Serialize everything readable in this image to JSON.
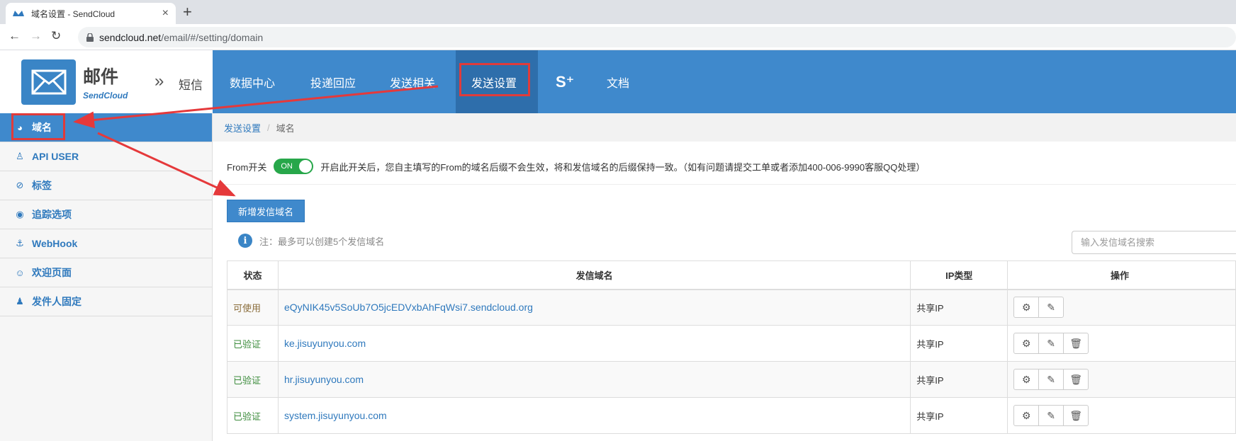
{
  "browser": {
    "tab_title": "域名设置 - SendCloud",
    "tab_close": "×",
    "new_tab": "+",
    "url_host": "sendcloud.net",
    "url_path": "/email/#/setting/domain",
    "back": "←",
    "forward": "→",
    "reload": "↻"
  },
  "brand": {
    "title": "邮件",
    "subtitle": "SendCloud",
    "switch_arrow": "»",
    "sms": "短信"
  },
  "topnav": {
    "items": [
      {
        "label": "数据中心"
      },
      {
        "label": "投递回应"
      },
      {
        "label": "发送相关"
      },
      {
        "label": "发送设置"
      },
      {
        "label": "S⁺"
      },
      {
        "label": "文档"
      }
    ],
    "active_index": 3
  },
  "sidebar": {
    "items": [
      {
        "label": "域名",
        "icon": "globe-icon",
        "glyph": "◕"
      },
      {
        "label": "API USER",
        "icon": "user-icon",
        "glyph": "♙"
      },
      {
        "label": "标签",
        "icon": "tag-icon",
        "glyph": "⊘"
      },
      {
        "label": "追踪选项",
        "icon": "eye-icon",
        "glyph": "◉"
      },
      {
        "label": "WebHook",
        "icon": "anchor-icon",
        "glyph": "⚓"
      },
      {
        "label": "欢迎页面",
        "icon": "smile-icon",
        "glyph": "☺"
      },
      {
        "label": "发件人固定",
        "icon": "users-icon",
        "glyph": "♟"
      }
    ]
  },
  "breadcrumb": {
    "parent": "发送设置",
    "sep": "/",
    "current": "域名"
  },
  "from_switch": {
    "label": "From开关",
    "state": "ON",
    "description": "开启此开关后，您自主填写的From的域名后缀不会生效，将和发信域名的后缀保持一致。（如有问题请提交工单或者添加400-006-9990客服QQ处理）"
  },
  "add_button": "新增发信域名",
  "note": {
    "icon": "i",
    "text": "注：最多可以创建5个发信域名"
  },
  "search": {
    "placeholder": "输入发信域名搜索"
  },
  "table": {
    "headers": [
      "状态",
      "发信域名",
      "IP类型",
      "操作"
    ],
    "rows": [
      {
        "status": "可使用",
        "domain": "eQyNIK45v5SoUb7O5jcEDVxbAhFqWsi7.sendcloud.org",
        "ip": "共享IP",
        "ops": [
          "⚙",
          "✎"
        ]
      },
      {
        "status": "已验证",
        "domain": "ke.jisuyunyou.com",
        "ip": "共享IP",
        "ops": [
          "⚙",
          "✎",
          "🗑"
        ]
      },
      {
        "status": "已验证",
        "domain": "hr.jisuyunyou.com",
        "ip": "共享IP",
        "ops": [
          "⚙",
          "✎",
          "🗑"
        ]
      },
      {
        "status": "已验证",
        "domain": "system.jisuyunyou.com",
        "ip": "共享IP",
        "ops": [
          "⚙",
          "✎",
          "🗑"
        ]
      }
    ]
  },
  "colors": {
    "nav_blue": "#3f89cc",
    "nav_active": "#2e6eab",
    "highlight_red": "#e03b3b",
    "toggle_green": "#27a74a"
  }
}
